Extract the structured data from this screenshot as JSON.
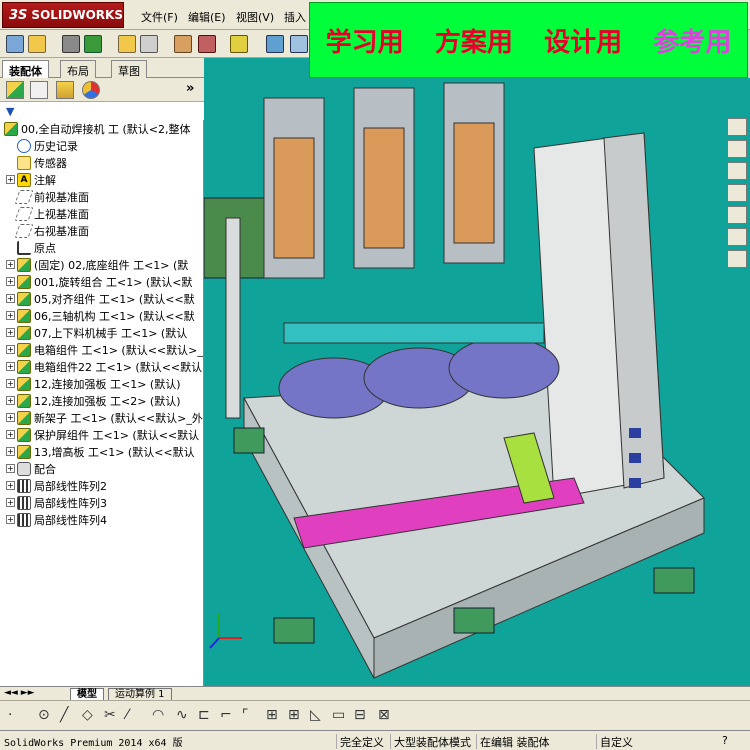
{
  "app": {
    "logo_prefix": "3S",
    "logo_text": "SOLIDWORKS"
  },
  "menu": [
    "文件(F)",
    "编辑(E)",
    "视图(V)",
    "插入"
  ],
  "banner": {
    "items": [
      "学习用",
      "方案用",
      "设计用",
      "参考用"
    ]
  },
  "panel_tabs": [
    "装配体",
    "布局",
    "草图"
  ],
  "tree": {
    "root": "00,全自动焊接机 工 (默认<2,整体",
    "items": [
      {
        "label": "历史记录",
        "icon": "history-icon",
        "expand": false
      },
      {
        "label": "传感器",
        "icon": "sensor-icon",
        "expand": false
      },
      {
        "label": "注解",
        "icon": "annotation-icon",
        "expand": true
      },
      {
        "label": "前视基准面",
        "icon": "plane-icon",
        "expand": false
      },
      {
        "label": "上视基准面",
        "icon": "plane-icon",
        "expand": false
      },
      {
        "label": "右视基准面",
        "icon": "plane-icon",
        "expand": false
      },
      {
        "label": "原点",
        "icon": "origin-icon",
        "expand": false
      },
      {
        "label": "(固定) 02,底座组件 工<1> (默",
        "icon": "assembly-icon",
        "expand": true
      },
      {
        "label": "001,旋转组合 工<1> (默认<默",
        "icon": "assembly-icon",
        "expand": true
      },
      {
        "label": "05,对齐组件 工<1> (默认<<默",
        "icon": "assembly-icon",
        "expand": true
      },
      {
        "label": "06,三轴机构 工<1> (默认<<默",
        "icon": "assembly-icon",
        "expand": true
      },
      {
        "label": "07,上下料机械手 工<1> (默认",
        "icon": "assembly-icon",
        "expand": true
      },
      {
        "label": "电箱组件 工<1> (默认<<默认>_",
        "icon": "assembly-icon",
        "expand": true
      },
      {
        "label": "电箱组件22 工<1> (默认<<默认",
        "icon": "assembly-icon",
        "expand": true
      },
      {
        "label": "12,连接加强板 工<1> (默认)",
        "icon": "assembly-icon",
        "expand": true
      },
      {
        "label": "12,连接加强板 工<2> (默认)",
        "icon": "assembly-icon",
        "expand": true
      },
      {
        "label": "新架子 工<1> (默认<<默认>_外",
        "icon": "assembly-icon",
        "expand": true
      },
      {
        "label": "保护屏组件 工<1> (默认<<默认",
        "icon": "assembly-icon",
        "expand": true
      },
      {
        "label": "13,增高板 工<1> (默认<<默认",
        "icon": "assembly-icon",
        "expand": true
      },
      {
        "label": "配合",
        "icon": "mates-icon",
        "expand": true
      },
      {
        "label": "局部线性阵列2",
        "icon": "pattern-icon",
        "expand": true
      },
      {
        "label": "局部线性阵列3",
        "icon": "pattern-icon",
        "expand": true
      },
      {
        "label": "局部线性阵列4",
        "icon": "pattern-icon",
        "expand": true
      }
    ]
  },
  "bottom_tabs": [
    "模型",
    "运动算例 1"
  ],
  "status": {
    "left": "SolidWorks Premium 2014 x64 版",
    "fully_defined": "完全定义",
    "large_mode": "大型装配体模式",
    "editing": "在编辑 装配体",
    "custom": "自定义"
  },
  "colors": {
    "viewport_bg": "#0fa39a",
    "banner_bg": "#00ff3a",
    "banner_red": "#e8002a",
    "banner_pink": "#e040e0"
  }
}
